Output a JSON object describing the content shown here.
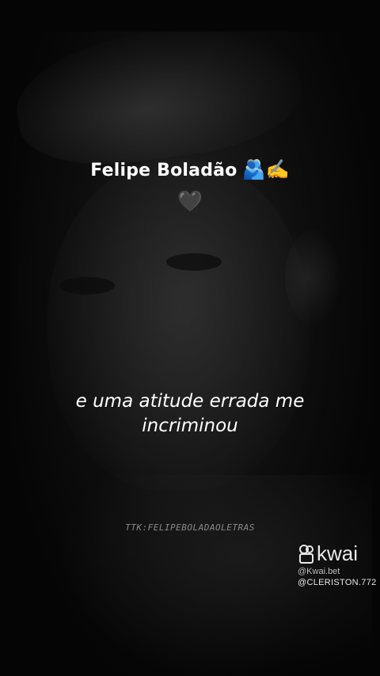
{
  "video": {
    "title": "Felipe Boladão",
    "title_emojis": "🫂✍️",
    "heart": "🖤",
    "lyrics_line1": "e uma atitude errada me",
    "lyrics_line2": "incriminou",
    "handle": "TTK:FELIPEBOLADAOLETRAS"
  },
  "watermark": {
    "brand": "kwai",
    "user_id": "@Kwai.bet",
    "creator": "@CLERISTON.772",
    "icon": "kwai-camera-icon"
  },
  "colors": {
    "background": "#050505",
    "text": "#ffffff",
    "heart": "#3a3a3a"
  }
}
